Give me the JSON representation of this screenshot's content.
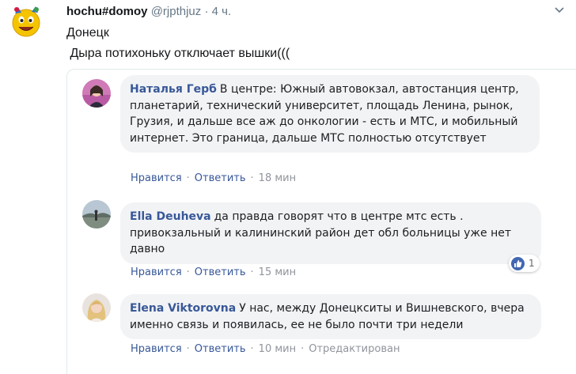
{
  "tweet": {
    "user_name": "hochu#domoy",
    "handle": "@rjpthjuz",
    "separator": "·",
    "time": "4 ч.",
    "lines": [
      "Донецк",
      " Дыра потихоньку отключает вышки((("
    ]
  },
  "comments": [
    {
      "author": "Наталья Герб",
      "text": "В центре: Южный автовокзал, автостанция центр, планетарий, технический университет, площадь Ленина, рынок, Грузия, и дальше все аж до онкологии - есть и МТС, и мобильный интернет. Это граница, дальше МТС полностью отсутствует",
      "like_label": "Нравится",
      "reply_label": "Ответить",
      "time": "18 мин"
    },
    {
      "author": "Ella Deuheva",
      "text": "да правда говорят что в центре мтс есть . привокзальный и калининский район дет обл больницы уже нет давно",
      "like_label": "Нравится",
      "reply_label": "Ответить",
      "time": "15 мин",
      "reaction_count": "1"
    },
    {
      "author": "Elena Viktorovna",
      "text": "У нас, между Донецкситы и Вишневского, вчера именно связь и появилась, ее не было почти три недели",
      "like_label": "Нравится",
      "reply_label": "Ответить",
      "time": "10 мин",
      "edited_label": "Отредактирован"
    }
  ],
  "icons": {
    "tweet_avatar": "smiley-face-avatar-icon",
    "caret": "chevron-down-icon",
    "reaction": "thumbs-up-icon"
  },
  "colors": {
    "fb_link": "#385898",
    "bubble": "#f2f3f5",
    "like_blue": "#4267b2"
  }
}
